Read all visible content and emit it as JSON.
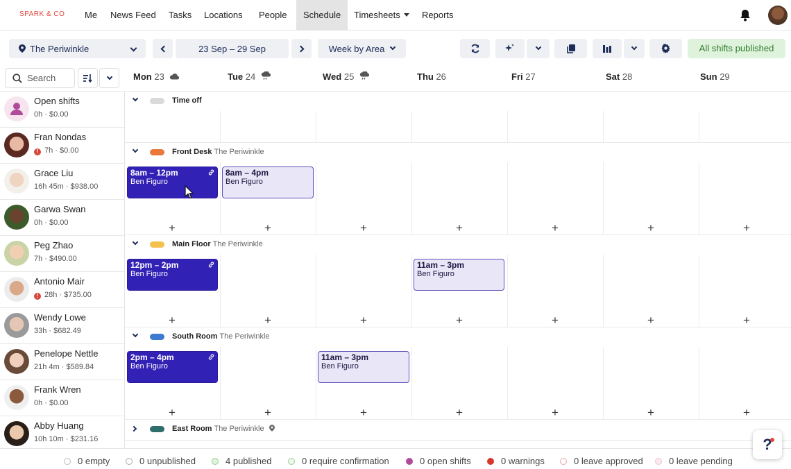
{
  "nav": {
    "logo": "SPARK & CO",
    "items": [
      "Me",
      "News Feed",
      "Tasks",
      "Locations",
      "People",
      "Schedule",
      "Timesheets",
      "Reports"
    ],
    "active": "Schedule"
  },
  "toolbar": {
    "location": "The Periwinkle",
    "date_range": "23 Sep – 29 Sep",
    "view": "Week by Area",
    "published_label": "All shifts published"
  },
  "search": {
    "placeholder": "Search"
  },
  "days": [
    {
      "name": "Mon",
      "num": "23",
      "weather": "cloud"
    },
    {
      "name": "Tue",
      "num": "24",
      "weather": "rain"
    },
    {
      "name": "Wed",
      "num": "25",
      "weather": "rain"
    },
    {
      "name": "Thu",
      "num": "26",
      "weather": ""
    },
    {
      "name": "Fri",
      "num": "27",
      "weather": ""
    },
    {
      "name": "Sat",
      "num": "28",
      "weather": ""
    },
    {
      "name": "Sun",
      "num": "29",
      "weather": ""
    }
  ],
  "people": [
    {
      "name": "Open shifts",
      "meta": "0h · $0.00",
      "warn": false
    },
    {
      "name": "Fran Nondas",
      "meta": "7h · $0.00",
      "warn": true
    },
    {
      "name": "Grace Liu",
      "meta": "16h 45m · $938.00",
      "warn": false
    },
    {
      "name": "Garwa Swan",
      "meta": "0h · $0.00",
      "warn": false
    },
    {
      "name": "Peg Zhao",
      "meta": "7h · $490.00",
      "warn": false
    },
    {
      "name": "Antonio Mair",
      "meta": "28h · $735.00",
      "warn": true
    },
    {
      "name": "Wendy Lowe",
      "meta": "33h · $682.49",
      "warn": false
    },
    {
      "name": "Penelope Nettle",
      "meta": "21h 4m · $589.84",
      "warn": false
    },
    {
      "name": "Frank Wren",
      "meta": "0h · $0.00",
      "warn": false
    },
    {
      "name": "Abby Huang",
      "meta": "10h 10m · $231.16",
      "warn": false
    }
  ],
  "areas": [
    {
      "name": "Time off",
      "location": "",
      "color": "#d9d9d9"
    },
    {
      "name": "Front Desk",
      "location": "The Periwinkle",
      "color": "#e8793a"
    },
    {
      "name": "Main Floor",
      "location": "The Periwinkle",
      "color": "#f2c14e"
    },
    {
      "name": "South Room",
      "location": "The Periwinkle",
      "color": "#3c7bd0"
    },
    {
      "name": "East Room",
      "location": "The Periwinkle",
      "color": "#2f6e6a"
    }
  ],
  "shifts": [
    {
      "time": "8am – 12pm",
      "person": "Ben Figuro"
    },
    {
      "time": "8am – 4pm",
      "person": "Ben Figuro"
    },
    {
      "time": "12pm – 2pm",
      "person": "Ben Figuro"
    },
    {
      "time": "11am – 3pm",
      "person": "Ben Figuro"
    },
    {
      "time": "2pm – 4pm",
      "person": "Ben Figuro"
    },
    {
      "time": "11am – 3pm",
      "person": "Ben Figuro"
    }
  ],
  "status": [
    {
      "label": "0 empty",
      "color": "#ffffff"
    },
    {
      "label": "0 unpublished",
      "color": "#ffffff"
    },
    {
      "label": "4 published",
      "color": "#dff3dc"
    },
    {
      "label": "0 require confirmation",
      "color": "#dff3dc"
    },
    {
      "label": "0 open shifts",
      "color": "#b14a9a"
    },
    {
      "label": "0 warnings",
      "color": "#d8362b"
    },
    {
      "label": "0 leave approved",
      "color": "#fbe3e3"
    },
    {
      "label": "0 leave pending",
      "color": "#fbe8f0"
    }
  ]
}
